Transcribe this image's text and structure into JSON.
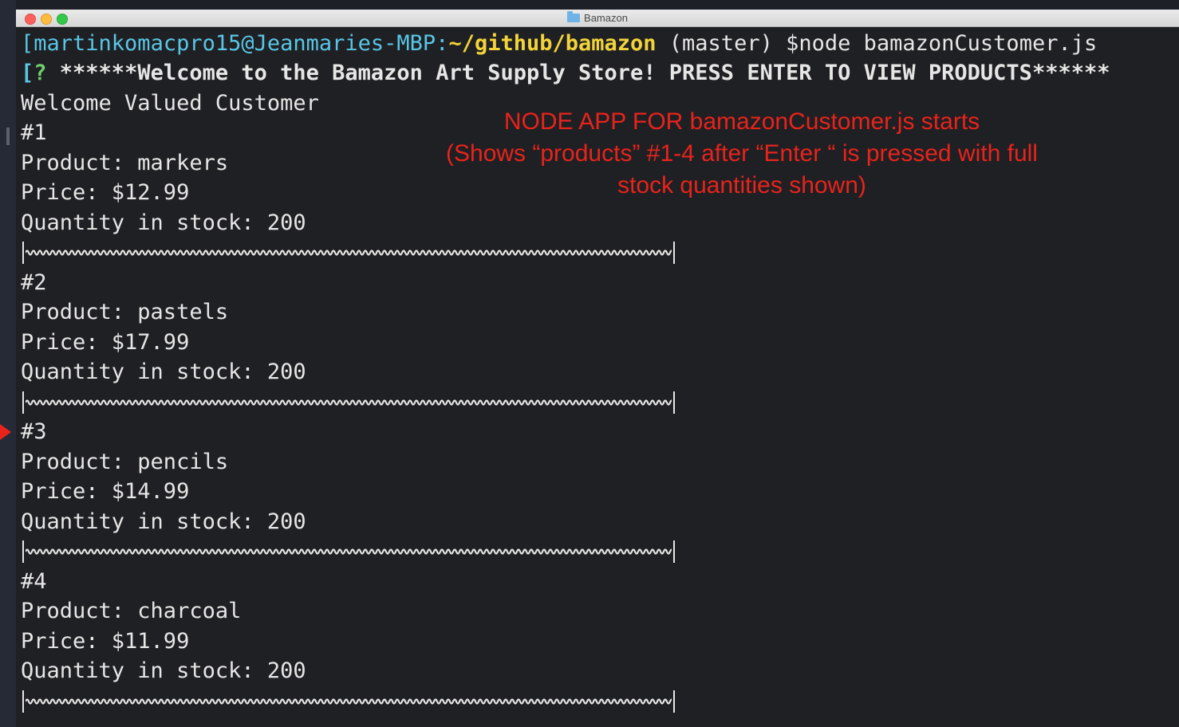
{
  "window": {
    "title": "Bamazon"
  },
  "prompt": {
    "user_host": "martinkomacpro15@Jeanmaries-MBP:",
    "path": "~/github/bamazon",
    "branch": " (master) ",
    "command": "$node bamazonCustomer.js"
  },
  "question": {
    "mark": "?",
    "text": " ******Welcome to the Bamazon Art Supply Store! PRESS ENTER TO VIEW PRODUCTS******"
  },
  "greeting": "Welcome Valued Customer",
  "products": [
    {
      "number": "#1",
      "product": "Product: markers",
      "price": "Price: $12.99",
      "stock": "Quantity in stock: 200"
    },
    {
      "number": "#2",
      "product": "Product: pastels",
      "price": "Price: $17.99",
      "stock": "Quantity in stock: 200"
    },
    {
      "number": "#3",
      "product": "Product: pencils",
      "price": "Price: $14.99",
      "stock": "Quantity in stock: 200"
    },
    {
      "number": "#4",
      "product": "Product: charcoal",
      "price": "Price: $11.99",
      "stock": "Quantity in stock: 200"
    }
  ],
  "annotation": {
    "line1": "NODE APP FOR bamazonCustomer.js starts",
    "line2": "(Shows “products” #1-4 after “Enter “ is pressed with full",
    "line3": "stock quantities shown)"
  },
  "colors": {
    "annotation": "#e8231c",
    "path": "#f2d33a",
    "user": "#59c6e6",
    "background": "#1f2023"
  }
}
